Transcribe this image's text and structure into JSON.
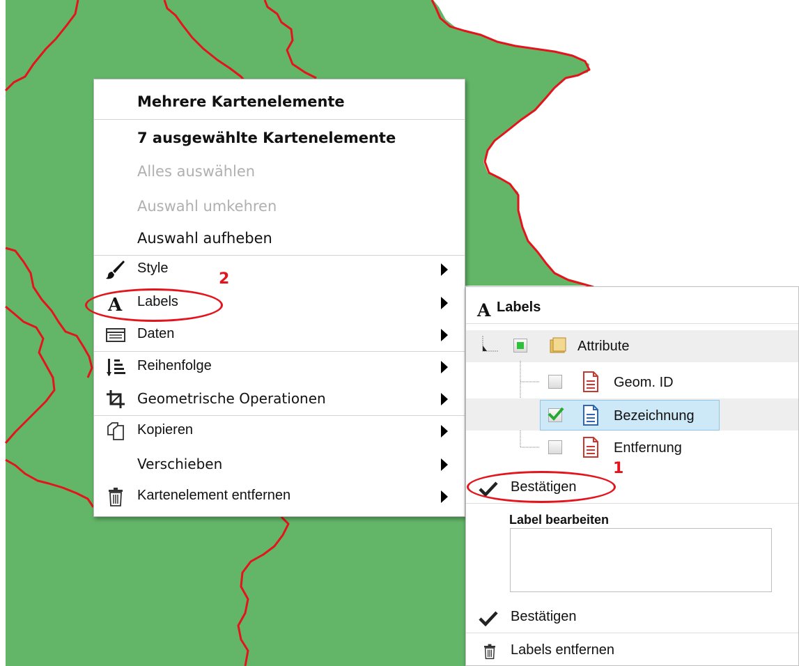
{
  "colors": {
    "map_green": "#63b668",
    "border_red": "#e4141c",
    "selection_blue": "#cde8f7"
  },
  "context_menu": {
    "title": "Mehrere Kartenelemente",
    "selected_count": "7 ausgewählte Kartenelemente",
    "select_all": "Alles auswählen",
    "invert_selection": "Auswahl umkehren",
    "clear_selection": "Auswahl aufheben",
    "items": {
      "style": {
        "label": "Style",
        "icon": "brush-icon"
      },
      "labels": {
        "label": "Labels",
        "icon": "letter-a-icon"
      },
      "daten": {
        "label": "Daten",
        "icon": "table-icon"
      },
      "reihenfolge": {
        "label": "Reihenfolge",
        "icon": "order-icon"
      },
      "geometrische": {
        "label": "Geometrische Operationen",
        "icon": "crop-icon"
      },
      "kopieren": {
        "label": "Kopieren",
        "icon": "copy-icon"
      },
      "verschieben": {
        "label": "Verschieben"
      },
      "entfernen": {
        "label": "Kartenelement entfernen",
        "icon": "trash-icon"
      }
    }
  },
  "labels_panel": {
    "title": "Labels",
    "tree": {
      "root": "Attribute",
      "children": [
        {
          "label": "Geom. ID",
          "checked": false,
          "icon_color": "red"
        },
        {
          "label": "Bezeichnung",
          "checked": true,
          "icon_color": "blue"
        },
        {
          "label": "Entfernung",
          "checked": false,
          "icon_color": "red"
        }
      ]
    },
    "confirm_1": "Bestätigen",
    "edit_label_heading": "Label bearbeiten",
    "edit_label_value": "",
    "confirm_2": "Bestätigen",
    "remove_labels": "Labels entfernen"
  },
  "annotations": {
    "step1": "1",
    "step2": "2"
  }
}
